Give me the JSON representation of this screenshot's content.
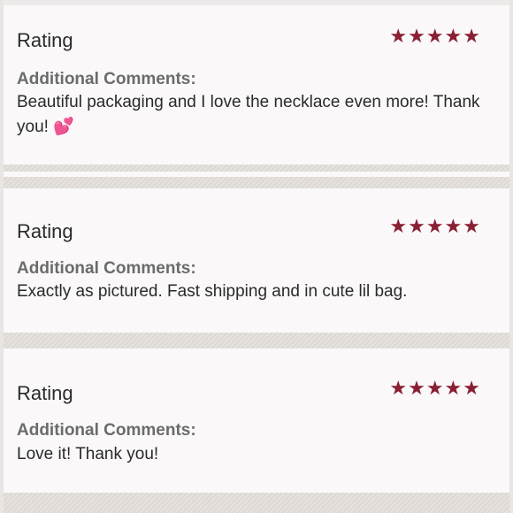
{
  "reviews": [
    {
      "title": "Rating",
      "stars": "★★★★★",
      "rating": 5,
      "label": "Additional Comments:",
      "comment": "Beautiful packaging and I love the necklace even more! Thank you! 💕"
    },
    {
      "title": "Rating",
      "stars": "★★★★★",
      "rating": 5,
      "label": "Additional Comments:",
      "comment": "Exactly as pictured. Fast shipping and in cute lil bag."
    },
    {
      "title": "Rating",
      "stars": "★★★★★",
      "rating": 5,
      "label": "Additional Comments:",
      "comment": "Love it! Thank you!"
    }
  ],
  "colors": {
    "star": "#8a1f33",
    "background": "#faf8f9",
    "divider": "#e0dcd8"
  }
}
